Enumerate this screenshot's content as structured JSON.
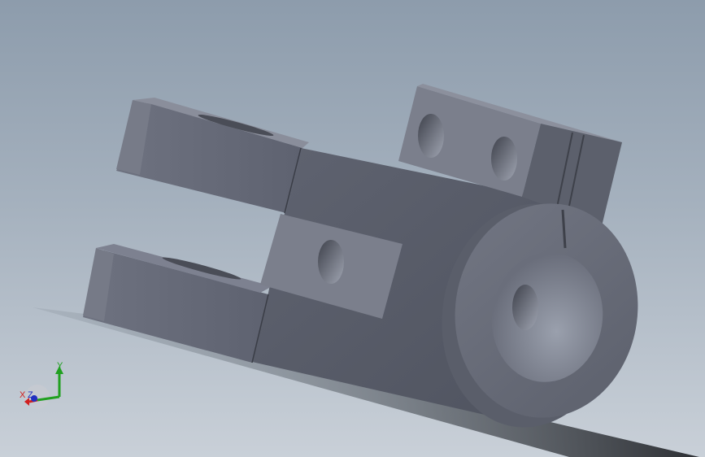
{
  "scene": {
    "background_top": "#8d9cac",
    "background_bottom": "#c9d0d8",
    "part_color": "#6b6f7c",
    "part_dark": "#505460",
    "part_light": "#8a8e9b"
  },
  "triad": {
    "x_label": "X",
    "y_label": "Y",
    "z_label": "Z",
    "x_color": "#d02020",
    "y_color": "#20a020",
    "z_color": "#2030c0"
  }
}
